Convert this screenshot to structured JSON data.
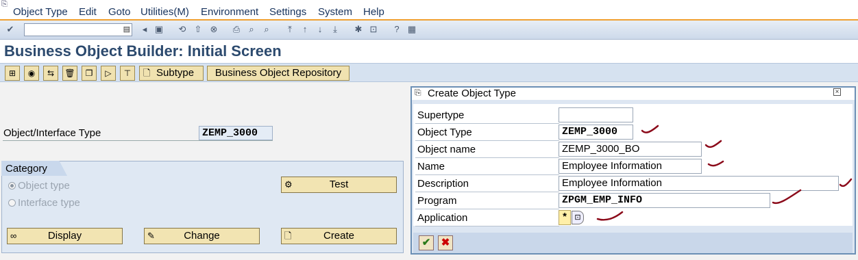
{
  "menubar": {
    "items": [
      "Object Type",
      "Edit",
      "Goto",
      "Utilities(M)",
      "Environment",
      "Settings",
      "System",
      "Help"
    ]
  },
  "stdbar": {
    "command_value": ""
  },
  "title": "Business Object Builder: Initial Screen",
  "apptoolbar": {
    "subtype_label": "Subtype",
    "repository_label": "Business Object Repository"
  },
  "main": {
    "object_type_label": "Object/Interface Type",
    "object_type_value": "ZEMP_3000",
    "category": {
      "title": "Category",
      "radio_object": "Object type",
      "radio_interface": "Interface type",
      "selected": "Object type"
    },
    "buttons": {
      "test": "Test",
      "display": "Display",
      "change": "Change",
      "create": "Create"
    }
  },
  "dialog": {
    "title": "Create Object Type",
    "fields": {
      "supertype": {
        "label": "Supertype",
        "value": ""
      },
      "object_type": {
        "label": "Object Type",
        "value": "ZEMP_3000"
      },
      "object_name": {
        "label": "Object name",
        "value": "ZEMP_3000_BO"
      },
      "name": {
        "label": "Name",
        "value": "Employee Information"
      },
      "description": {
        "label": "Description",
        "value": "Employee Information"
      },
      "program": {
        "label": "Program",
        "value": "ZPGM_EMP_INFO"
      },
      "application": {
        "label": "Application",
        "value": "*"
      }
    },
    "confirm_icon": "check-icon",
    "cancel_icon": "cancel-x-icon"
  },
  "colors": {
    "title": "#2c4a6e",
    "button_bg": "#f2e4b2",
    "toolbar_bg": "#d6e2f0",
    "annotation": "#8b0a1a"
  }
}
